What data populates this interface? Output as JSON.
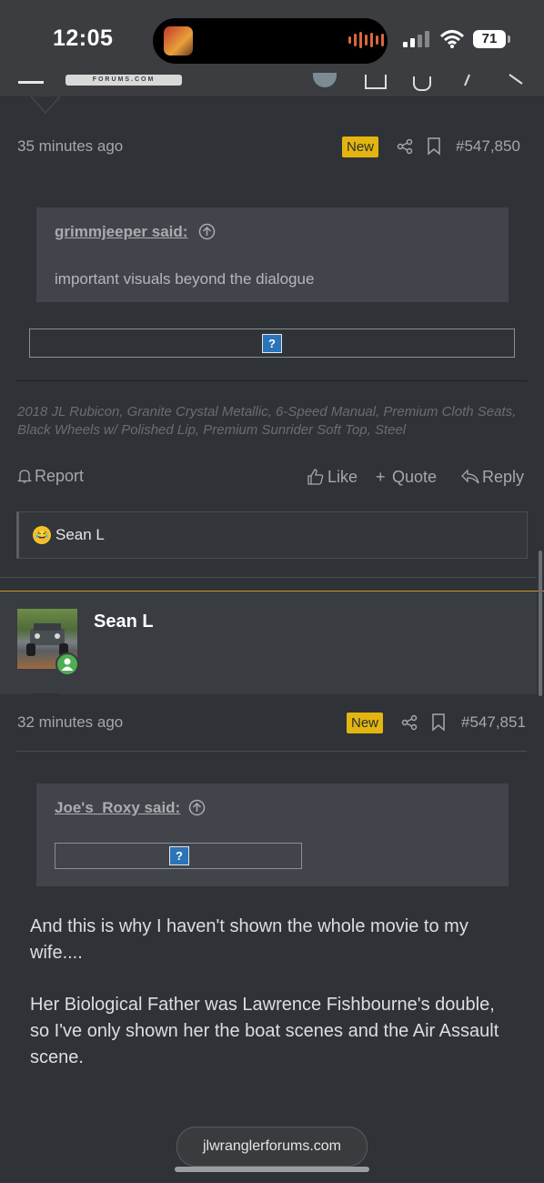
{
  "status": {
    "time": "12:05",
    "battery": "71"
  },
  "nav": {
    "logo_text": "FORUMS.COM"
  },
  "post1": {
    "time": "35 minutes ago",
    "badge": "New",
    "post_number": "#547,850",
    "quote_author": "grimmjeeper said:",
    "quote_text": "important visuals beyond the dialogue",
    "signature": "2018 JL Rubicon, Granite Crystal Metallic, 6-Speed Manual, Premium Cloth Seats, Black Wheels w/ Polished Lip, Premium Sunrider Soft Top, Steel",
    "actions": {
      "report": "Report",
      "like": "Like",
      "quote": "Quote",
      "reply": "Reply"
    },
    "reaction_user": "Sean L"
  },
  "post2": {
    "username": "Sean L",
    "time": "32 minutes ago",
    "badge": "New",
    "post_number": "#547,851",
    "quote_author": "Joe's_Roxy said:",
    "message_p1": "And this is why I haven't shown the whole movie to my wife....",
    "message_p2": "Her Biological Father was Lawrence Fishbourne's double, so I've only shown her the boat scenes and the Air Assault scene."
  },
  "browser": {
    "url": "jlwranglerforums.com"
  },
  "image_placeholder": "?",
  "colors": {
    "accent_badge": "#e3b510",
    "post_separator": "#c9962d",
    "online": "#4caf50"
  }
}
